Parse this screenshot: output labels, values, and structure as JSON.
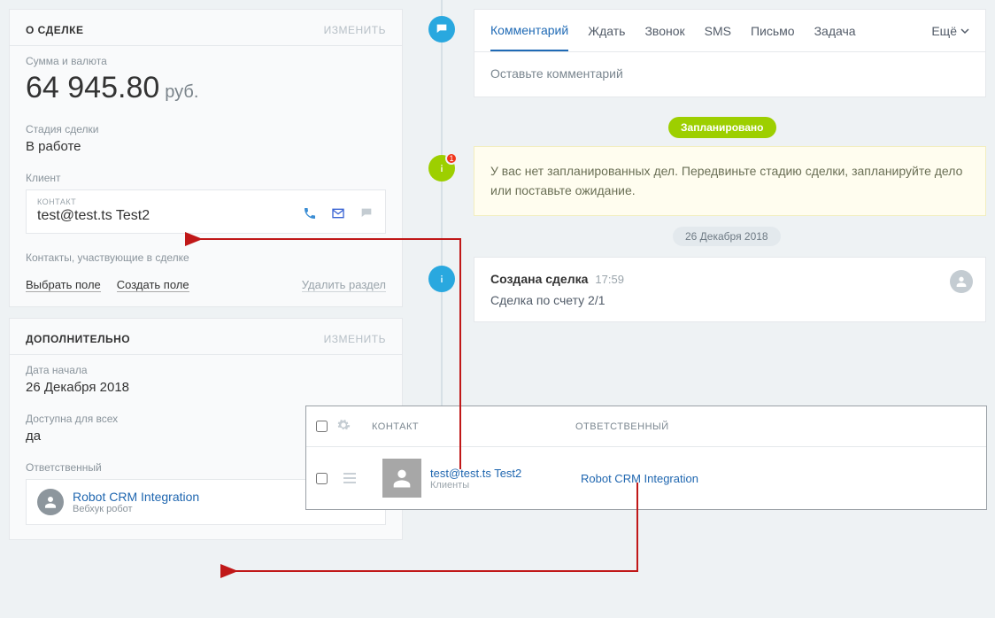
{
  "about": {
    "title": "О СДЕЛКЕ",
    "edit": "ИЗМЕНИТЬ",
    "sum_label": "Сумма и валюта",
    "amount": "64 945.80",
    "currency": "руб.",
    "stage_label": "Стадия сделки",
    "stage_value": "В работе",
    "client_label": "Клиент",
    "contact_type": "КОНТАКТ",
    "contact_name": "test@test.ts Test2",
    "participants": "Контакты, участвующие в сделке",
    "select_field": "Выбрать поле",
    "create_field": "Создать поле",
    "delete_section": "Удалить раздел"
  },
  "extra": {
    "title": "ДОПОЛНИТЕЛЬНО",
    "edit": "ИЗМЕНИТЬ",
    "start_label": "Дата начала",
    "start_value": "26 Декабря 2018",
    "access_label": "Доступна для всех",
    "access_value": "да",
    "resp_label": "Ответственный",
    "resp_name": "Robot CRM Integration",
    "resp_sub": "Вебхук робот"
  },
  "timeline": {
    "tabs": {
      "comment": "Комментарий",
      "wait": "Ждать",
      "call": "Звонок",
      "sms": "SMS",
      "letter": "Письмо",
      "task": "Задача",
      "more": "Ещё"
    },
    "comment_placeholder": "Оставьте комментарий",
    "planned_pill": "Запланировано",
    "warning": "У вас нет запланированных дел. Передвиньте стадию сделки, запланируйте дело или поставьте ожидание.",
    "badge_count": "1",
    "date_chip": "26 Декабря 2018",
    "event_title": "Создана сделка",
    "event_time": "17:59",
    "event_body": "Сделка по счету 2/1"
  },
  "table": {
    "col_contact": "КОНТАКТ",
    "col_responsible": "ОТВЕТСТВЕННЫЙ",
    "contact_name": "test@test.ts Test2",
    "contact_sub": "Клиенты",
    "resp_name": "Robot CRM Integration"
  }
}
